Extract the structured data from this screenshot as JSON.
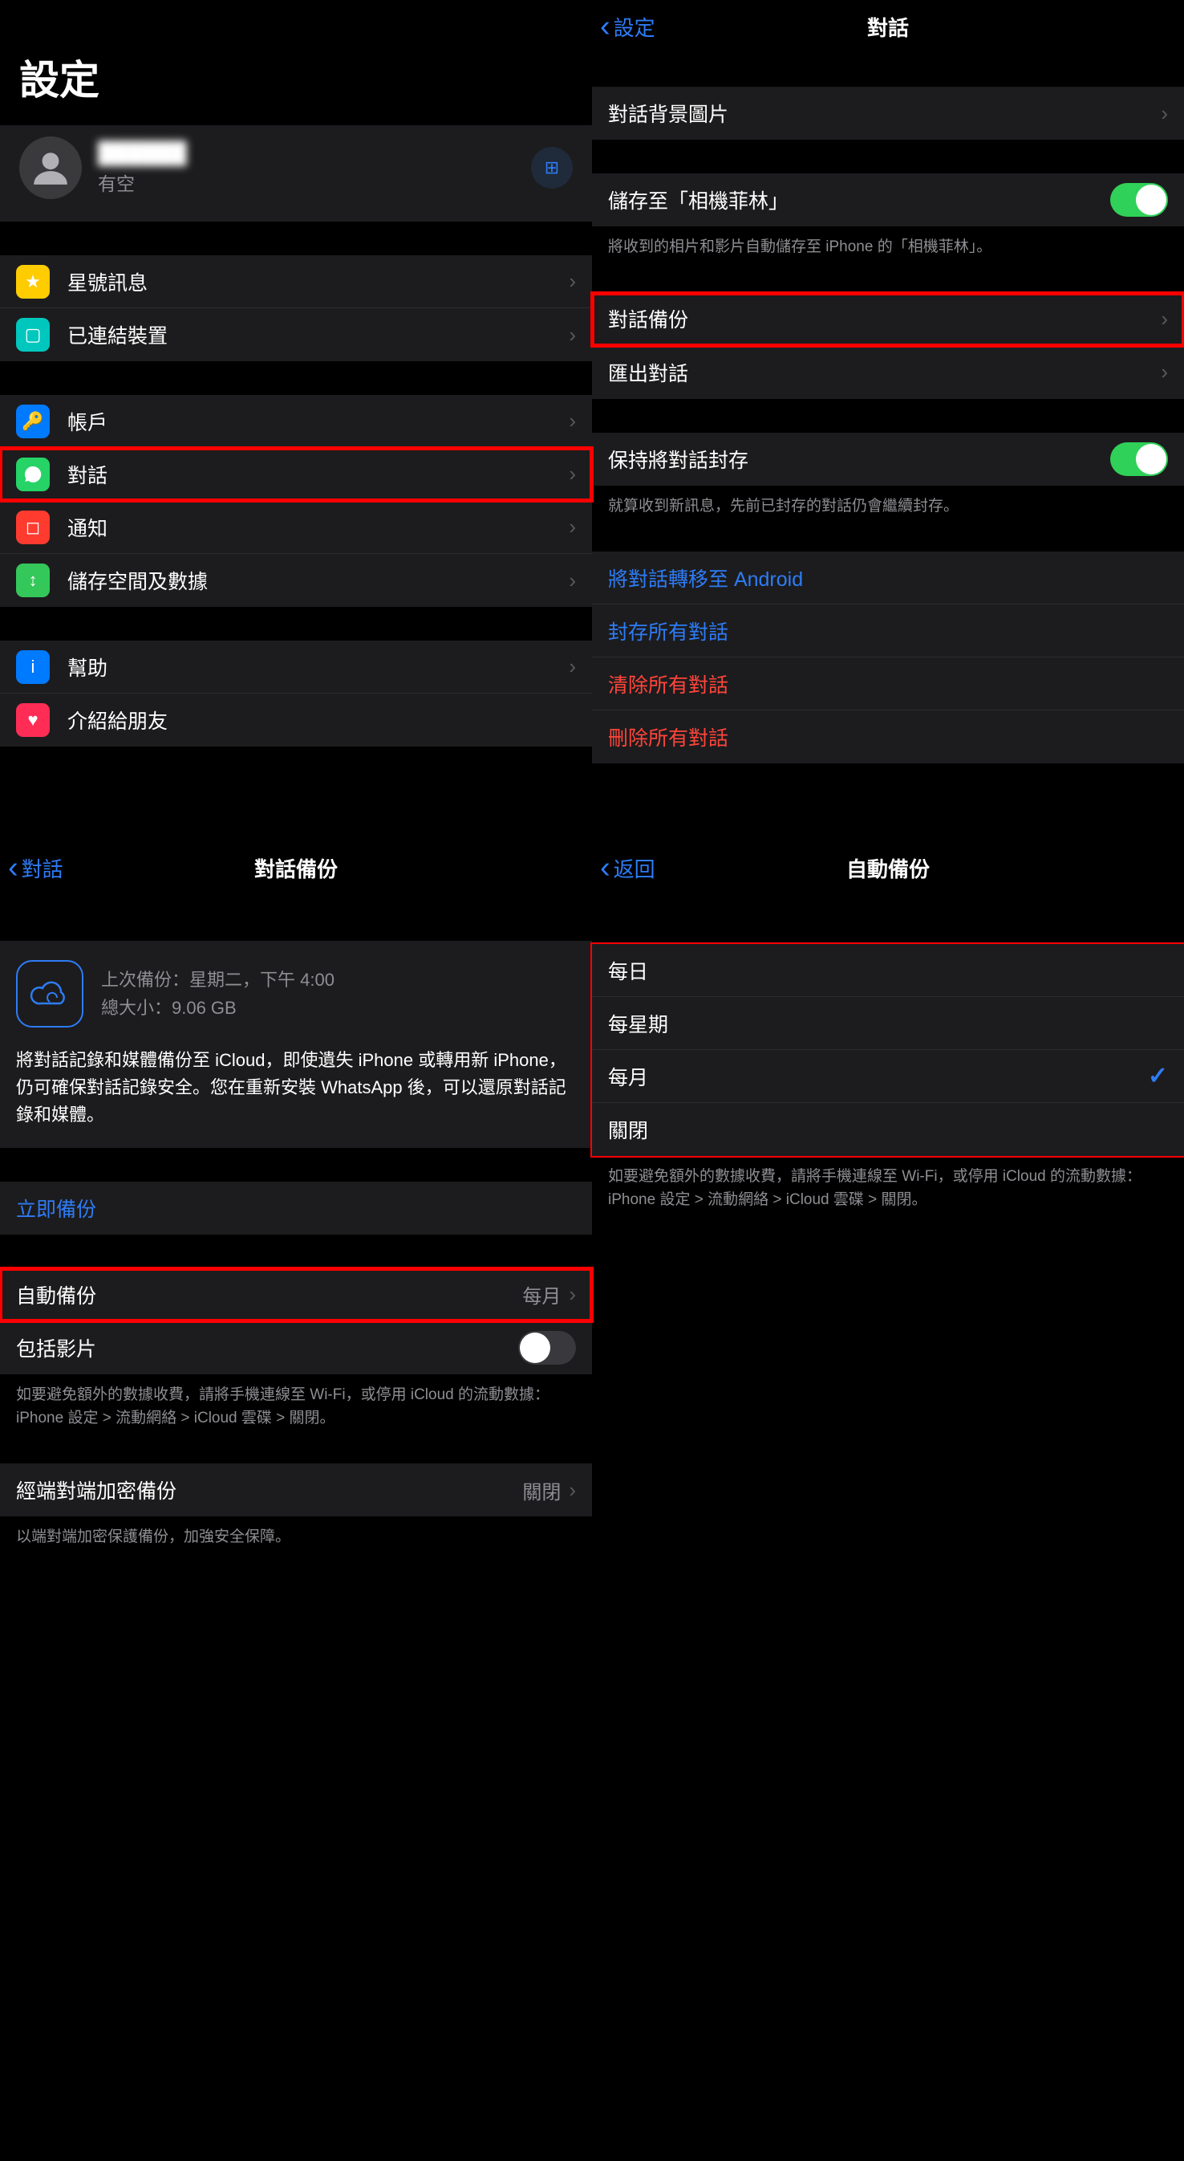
{
  "tl": {
    "title": "設定",
    "profile": {
      "name": "██████",
      "status": "有空"
    },
    "g1": [
      {
        "icon": "star",
        "label": "星號訊息"
      },
      {
        "icon": "link",
        "label": "已連結裝置"
      }
    ],
    "g2": [
      {
        "icon": "key",
        "label": "帳戶"
      },
      {
        "icon": "chat",
        "label": "對話",
        "hl": true
      },
      {
        "icon": "bell",
        "label": "通知"
      },
      {
        "icon": "data",
        "label": "儲存空間及數據"
      }
    ],
    "g3": [
      {
        "icon": "info",
        "label": "幫助"
      },
      {
        "icon": "heart",
        "label": "介紹給朋友"
      }
    ]
  },
  "tr": {
    "back": "設定",
    "title": "對話",
    "rows1": [
      {
        "label": "對話背景圖片",
        "chev": true
      }
    ],
    "rows2": [
      {
        "label": "儲存至「相機菲林」",
        "toggle": "on"
      }
    ],
    "note2": "將收到的相片和影片自動儲存至 iPhone 的「相機菲林」。",
    "rows3": [
      {
        "label": "對話備份",
        "chev": true,
        "hl": true
      },
      {
        "label": "匯出對話",
        "chev": true
      }
    ],
    "rows4": [
      {
        "label": "保持將對話封存",
        "toggle": "on"
      }
    ],
    "note4": "就算收到新訊息，先前已封存的對話仍會繼續封存。",
    "rows5": [
      {
        "label": "將對話轉移至 Android",
        "cls": "blue"
      },
      {
        "label": "封存所有對話",
        "cls": "blue"
      },
      {
        "label": "清除所有對話",
        "cls": "red"
      },
      {
        "label": "刪除所有對話",
        "cls": "red"
      }
    ]
  },
  "bl": {
    "back": "對話",
    "title": "對話備份",
    "last": "上次備份：星期二，下午 4:00",
    "size": "總大小：9.06 GB",
    "desc": "將對話記錄和媒體備份至 iCloud，即使遺失 iPhone 或轉用新 iPhone，仍可確保對話記錄安全。您在重新安裝 WhatsApp 後，可以還原對話記錄和媒體。",
    "backupNow": "立即備份",
    "auto": {
      "label": "自動備份",
      "value": "每月"
    },
    "video": {
      "label": "包括影片"
    },
    "note": "如要避免額外的數據收費，請將手機連線至 Wi-Fi，或停用 iCloud 的流動數據：iPhone 設定 > 流動網絡 > iCloud 雲碟 > 關閉。",
    "e2e": {
      "label": "經端對端加密備份",
      "value": "關閉"
    },
    "e2eNote": "以端對端加密保護備份，加強安全保障。"
  },
  "br": {
    "back": "返回",
    "title": "自動備份",
    "options": [
      {
        "label": "每日"
      },
      {
        "label": "每星期"
      },
      {
        "label": "每月",
        "checked": true
      },
      {
        "label": "關閉"
      }
    ],
    "note": "如要避免額外的數據收費，請將手機連線至 Wi-Fi，或停用 iCloud 的流動數據：iPhone 設定 > 流動網絡 > iCloud 雲碟 > 關閉。"
  }
}
